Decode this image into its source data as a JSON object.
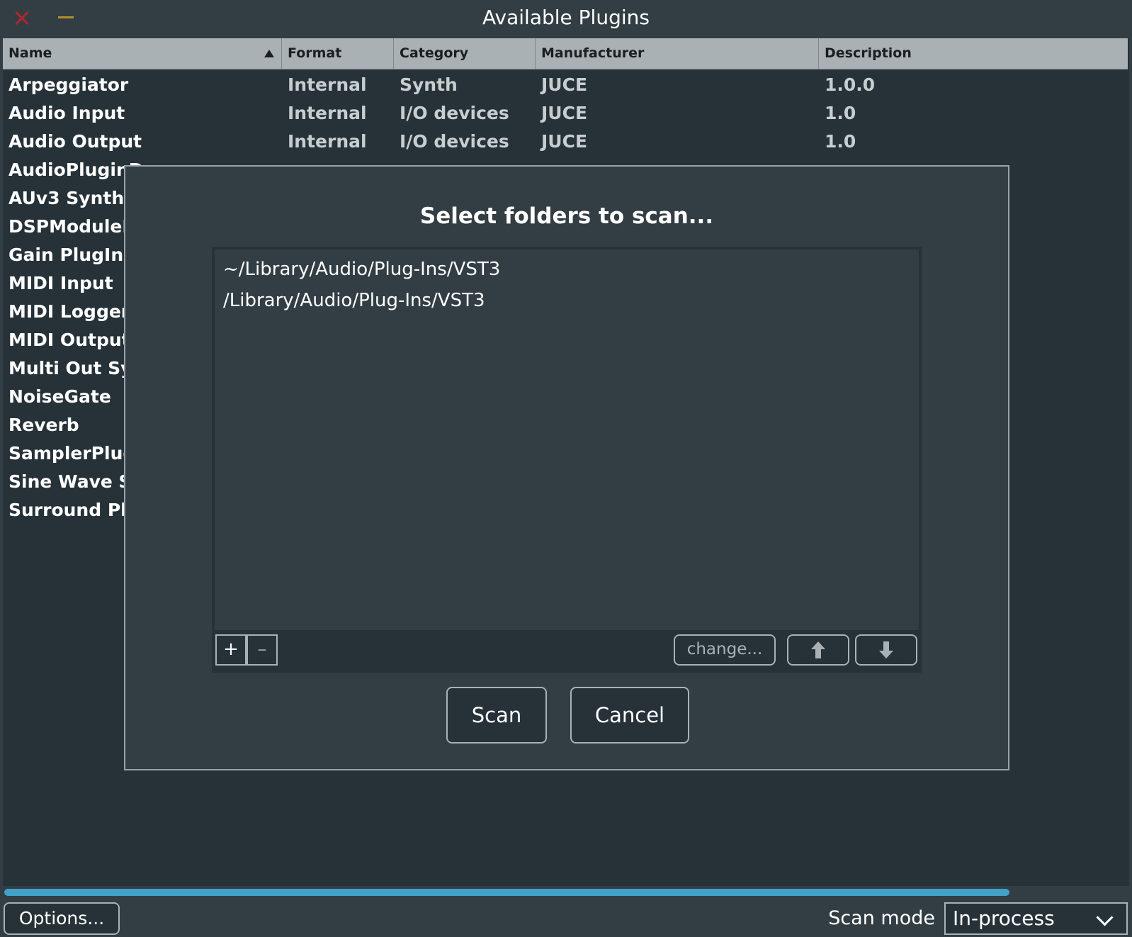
{
  "window": {
    "title": "Available Plugins"
  },
  "table": {
    "columns": [
      {
        "label": "Name"
      },
      {
        "label": "Format"
      },
      {
        "label": "Category"
      },
      {
        "label": "Manufacturer"
      },
      {
        "label": "Description"
      }
    ],
    "rows": [
      {
        "name": "Arpeggiator",
        "format": "Internal",
        "category": "Synth",
        "manufacturer": "JUCE",
        "description": "1.0.0"
      },
      {
        "name": "Audio Input",
        "format": "Internal",
        "category": "I/O devices",
        "manufacturer": "JUCE",
        "description": "1.0"
      },
      {
        "name": "Audio Output",
        "format": "Internal",
        "category": "I/O devices",
        "manufacturer": "JUCE",
        "description": "1.0"
      },
      {
        "name": "AudioPluginD",
        "format": "",
        "category": "",
        "manufacturer": "",
        "description": ""
      },
      {
        "name": "AUv3 Synth",
        "format": "",
        "category": "",
        "manufacturer": "",
        "description": ""
      },
      {
        "name": "DSPModulePl",
        "format": "",
        "category": "",
        "manufacturer": "",
        "description": ""
      },
      {
        "name": "Gain PlugIn",
        "format": "",
        "category": "",
        "manufacturer": "",
        "description": ""
      },
      {
        "name": "MIDI Input",
        "format": "",
        "category": "",
        "manufacturer": "",
        "description": ""
      },
      {
        "name": "MIDI Logger",
        "format": "",
        "category": "",
        "manufacturer": "",
        "description": ""
      },
      {
        "name": "MIDI Output",
        "format": "",
        "category": "",
        "manufacturer": "",
        "description": ""
      },
      {
        "name": "Multi Out Syn",
        "format": "",
        "category": "",
        "manufacturer": "",
        "description": ""
      },
      {
        "name": "NoiseGate",
        "format": "",
        "category": "",
        "manufacturer": "",
        "description": ""
      },
      {
        "name": "Reverb",
        "format": "",
        "category": "",
        "manufacturer": "",
        "description": ""
      },
      {
        "name": "SamplerPlugi",
        "format": "",
        "category": "",
        "manufacturer": "",
        "description": ""
      },
      {
        "name": "Sine Wave Syr",
        "format": "",
        "category": "",
        "manufacturer": "",
        "description": ""
      },
      {
        "name": "Surround Plug",
        "format": "",
        "category": "",
        "manufacturer": "",
        "description": ""
      }
    ]
  },
  "progress": {
    "fraction": 0.895
  },
  "footer": {
    "options_label": "Options...",
    "scan_mode_label": "Scan mode",
    "scan_mode_value": "In-process"
  },
  "dialog": {
    "title": "Select folders to scan...",
    "folders": [
      "~/Library/Audio/Plug-Ins/VST3",
      "/Library/Audio/Plug-Ins/VST3"
    ],
    "add_label": "+",
    "remove_label": "–",
    "change_label": "change...",
    "scan_label": "Scan",
    "cancel_label": "Cancel"
  },
  "colors": {
    "background": "#323e44",
    "table_background": "#263238",
    "header_background": "#aab1b5",
    "progress": "#42a2c8",
    "close": "#b3262c",
    "minimize": "#b38f2a"
  },
  "icons": {
    "close": "close-icon",
    "minimize": "minimize-icon",
    "sort": "sort-ascending-icon",
    "move_up": "arrow-up-icon",
    "move_down": "arrow-down-icon",
    "dropdown": "chevron-down-icon"
  }
}
